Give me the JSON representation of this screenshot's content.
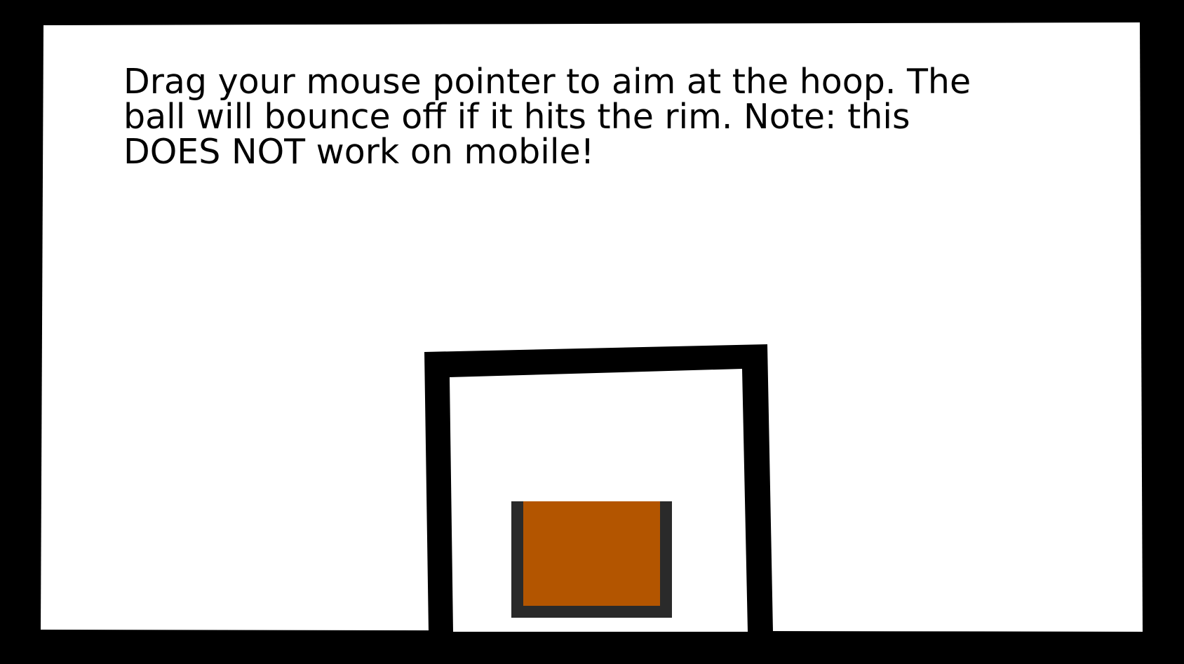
{
  "game": {
    "instructions": "Drag your mouse pointer to aim at the hoop. The ball will bounce off if it hits the rim. Note: this DOES NOT work on mobile!"
  },
  "colors": {
    "frame": "#000000",
    "court": "#ffffff",
    "ball": "#b35500",
    "ball_outline": "#2a2a2a"
  }
}
